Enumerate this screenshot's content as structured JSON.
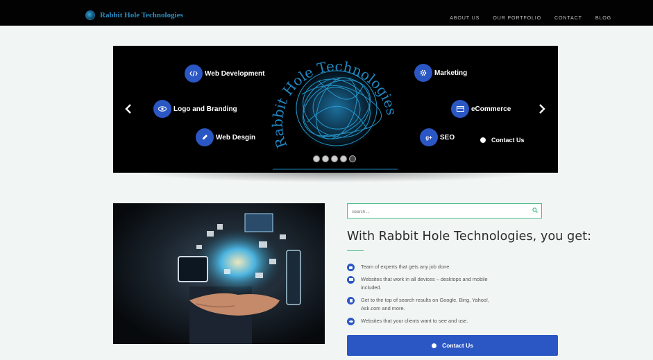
{
  "header": {
    "brand": "Rabbit Hole Technologies",
    "nav": [
      "ABOUT US",
      "OUR PORTFOLIO",
      "CONTACT",
      "BLOG"
    ]
  },
  "slider": {
    "logo_text": "Rabbit Hole Technologies",
    "services_left": [
      "Web Development",
      "Logo and Branding",
      "Web Desgin"
    ],
    "services_right": [
      "Marketing",
      "eCommerce",
      "SEO"
    ],
    "contact_label": "Contact Us",
    "active_slide": 5,
    "slide_count": 5
  },
  "search": {
    "placeholder": "Search ..."
  },
  "main": {
    "headline": "With Rabbit Hole Technologies, you get:",
    "features": [
      "Team of experts that gets any job done.",
      "Websites that work in all devices – desktops and mobile included.",
      "Get to the top of search results on Google, Bing, Yahoo!, Ask.com and more.",
      "Websites that your clients want to see and use."
    ],
    "cta_label": "Contact Us"
  },
  "colors": {
    "accent": "#2b57c4",
    "brand": "#2a8fc4",
    "green": "#4ebd8c"
  },
  "icons": [
    "code-icon",
    "eye-icon",
    "pencil-icon",
    "gear-icon",
    "card-icon",
    "google-plus-icon",
    "chevron-left-icon",
    "chevron-right-icon",
    "search-icon"
  ]
}
